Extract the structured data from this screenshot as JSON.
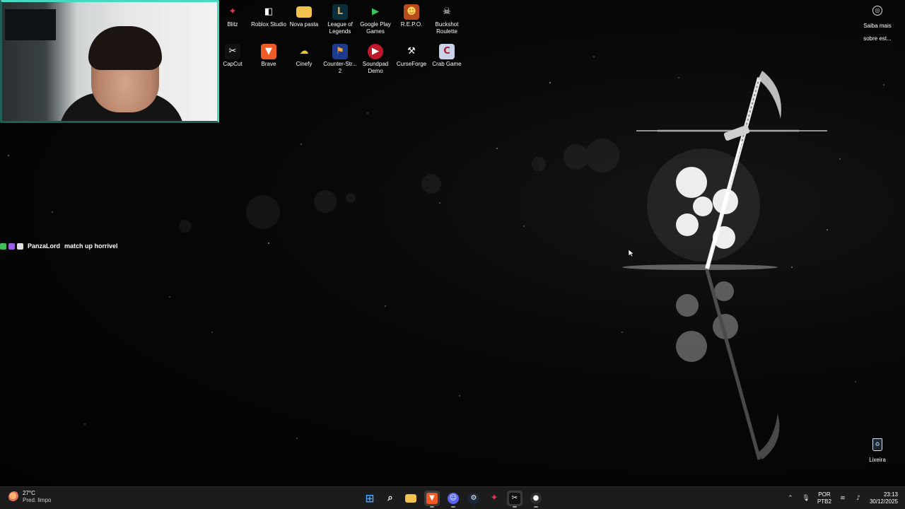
{
  "desktop": {
    "row1": [
      {
        "label": "Blitz",
        "icon": "blitz-icon",
        "color": "#e0344f",
        "glyph": "✦"
      },
      {
        "label": "Roblox Studio",
        "icon": "roblox-studio-icon",
        "color": "#1a1a1a",
        "glyph": "◧"
      },
      {
        "label": "Nova pasta",
        "icon": "folder-icon",
        "color": "#f2c14e",
        "glyph": ""
      },
      {
        "label": "League of Legends",
        "icon": "league-of-legends-icon",
        "color": "#0b2e3c",
        "glyph": "L"
      },
      {
        "label": "Google Play Games",
        "icon": "google-play-games-icon",
        "color": "#1e9e4f",
        "glyph": "▶"
      },
      {
        "label": "R.E.P.O.",
        "icon": "repo-icon",
        "color": "#b84b1c",
        "glyph": "☻"
      },
      {
        "label": "Buckshot Roulette",
        "icon": "buckshot-roulette-icon",
        "color": "#2a2a2a",
        "glyph": "☠"
      }
    ],
    "row2": [
      {
        "label": "CapCut",
        "icon": "capcut-icon",
        "color": "#111111",
        "glyph": "✂"
      },
      {
        "label": "Brave",
        "icon": "brave-icon",
        "color": "#f05a24",
        "glyph": "▼"
      },
      {
        "label": "Cinefy",
        "icon": "cinefy-icon",
        "color": "#e8c63a",
        "glyph": "☁"
      },
      {
        "label": "Counter-Str... 2",
        "icon": "counter-strike-icon",
        "color": "#1d3b8c",
        "glyph": "⚑"
      },
      {
        "label": "Soundpad Demo",
        "icon": "soundpad-icon",
        "color": "#c0182a",
        "glyph": "▶"
      },
      {
        "label": "CurseForge",
        "icon": "curseforge-icon",
        "color": "#2a2a2a",
        "glyph": "⚒"
      },
      {
        "label": "Crab Game",
        "icon": "crab-game-icon",
        "color": "#c9d2e8",
        "glyph": "C"
      }
    ],
    "learn_more": {
      "label": "Saiba mais sobre est...",
      "icon": "camera-info-icon"
    },
    "recycle_bin": {
      "label": "Lixeira",
      "icon": "recycle-bin-icon"
    }
  },
  "chat": {
    "username": "PanzaLord",
    "message": "match up horrivel",
    "badge_colors": [
      "#3fbf5c",
      "#9b5de5",
      "#e0e0e0"
    ]
  },
  "taskbar": {
    "weather": {
      "temp": "27°C",
      "condition": "Pred. limpo"
    },
    "apps": [
      {
        "name": "start-button",
        "icon": "windows-icon",
        "color": "#2d8cf0",
        "glyph": "⊞",
        "active": false
      },
      {
        "name": "search-button",
        "icon": "search-icon",
        "color": "transparent",
        "glyph": "⌕",
        "active": false
      },
      {
        "name": "taskbar-file-explorer",
        "icon": "folder-icon",
        "color": "#f2c14e",
        "glyph": "",
        "active": false
      },
      {
        "name": "taskbar-brave",
        "icon": "brave-icon",
        "color": "#f05a24",
        "glyph": "▼",
        "active": true
      },
      {
        "name": "taskbar-discord",
        "icon": "discord-icon",
        "color": "#5865f2",
        "glyph": "☺",
        "active": true
      },
      {
        "name": "taskbar-steam",
        "icon": "steam-icon",
        "color": "#1b2838",
        "glyph": "⚙",
        "active": false
      },
      {
        "name": "taskbar-blitz",
        "icon": "blitz-icon",
        "color": "#e0344f",
        "glyph": "✦",
        "active": false
      },
      {
        "name": "taskbar-capcut",
        "icon": "capcut-icon",
        "color": "#111111",
        "glyph": "✂",
        "active": true
      },
      {
        "name": "taskbar-obs",
        "icon": "obs-icon",
        "color": "#302e31",
        "glyph": "●",
        "active": true
      }
    ],
    "tray": {
      "lang_top": "POR",
      "lang_bottom": "PTB2",
      "time": "23:13",
      "date": "30/12/2025"
    }
  }
}
